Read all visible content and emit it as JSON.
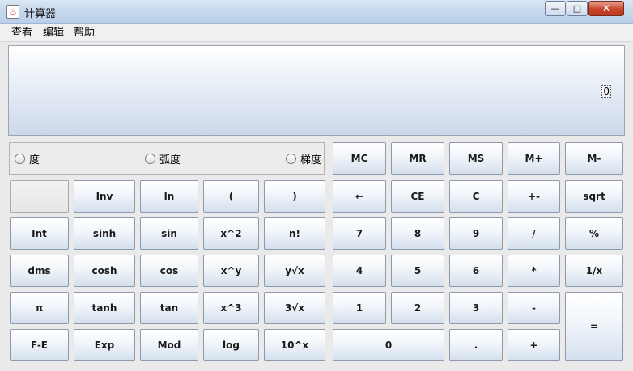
{
  "window": {
    "title": "计算器",
    "app_icon_glyph": "♨",
    "minimize_glyph": "—",
    "maximize_glyph": "□",
    "close_glyph": "✕"
  },
  "menu": {
    "items": [
      "查看",
      "编辑",
      "帮助"
    ]
  },
  "display": {
    "value": "0"
  },
  "angle_modes": {
    "options": [
      "度",
      "弧度",
      "梯度"
    ],
    "selected": null
  },
  "memory_buttons": [
    "MC",
    "MR",
    "MS",
    "M+",
    "M-"
  ],
  "scientific": {
    "row1": [
      "",
      "Inv",
      "ln",
      "(",
      ")"
    ],
    "row2": [
      "Int",
      "sinh",
      "sin",
      "x^2",
      "n!"
    ],
    "row3": [
      "dms",
      "cosh",
      "cos",
      "x^y",
      "y√x"
    ],
    "row4": [
      "π",
      "tanh",
      "tan",
      "x^3",
      "3√x"
    ],
    "row5": [
      "F-E",
      "Exp",
      "Mod",
      "log",
      "10^x"
    ]
  },
  "standard": {
    "row1": [
      "←",
      "CE",
      "C",
      "+-",
      "sqrt"
    ],
    "row2": [
      "7",
      "8",
      "9",
      "/",
      "%"
    ],
    "row3": [
      "4",
      "5",
      "6",
      "*",
      "1/x"
    ],
    "row4": [
      "1",
      "2",
      "3",
      "-"
    ],
    "row5": [
      "0",
      ".",
      "+"
    ],
    "equals": "="
  }
}
